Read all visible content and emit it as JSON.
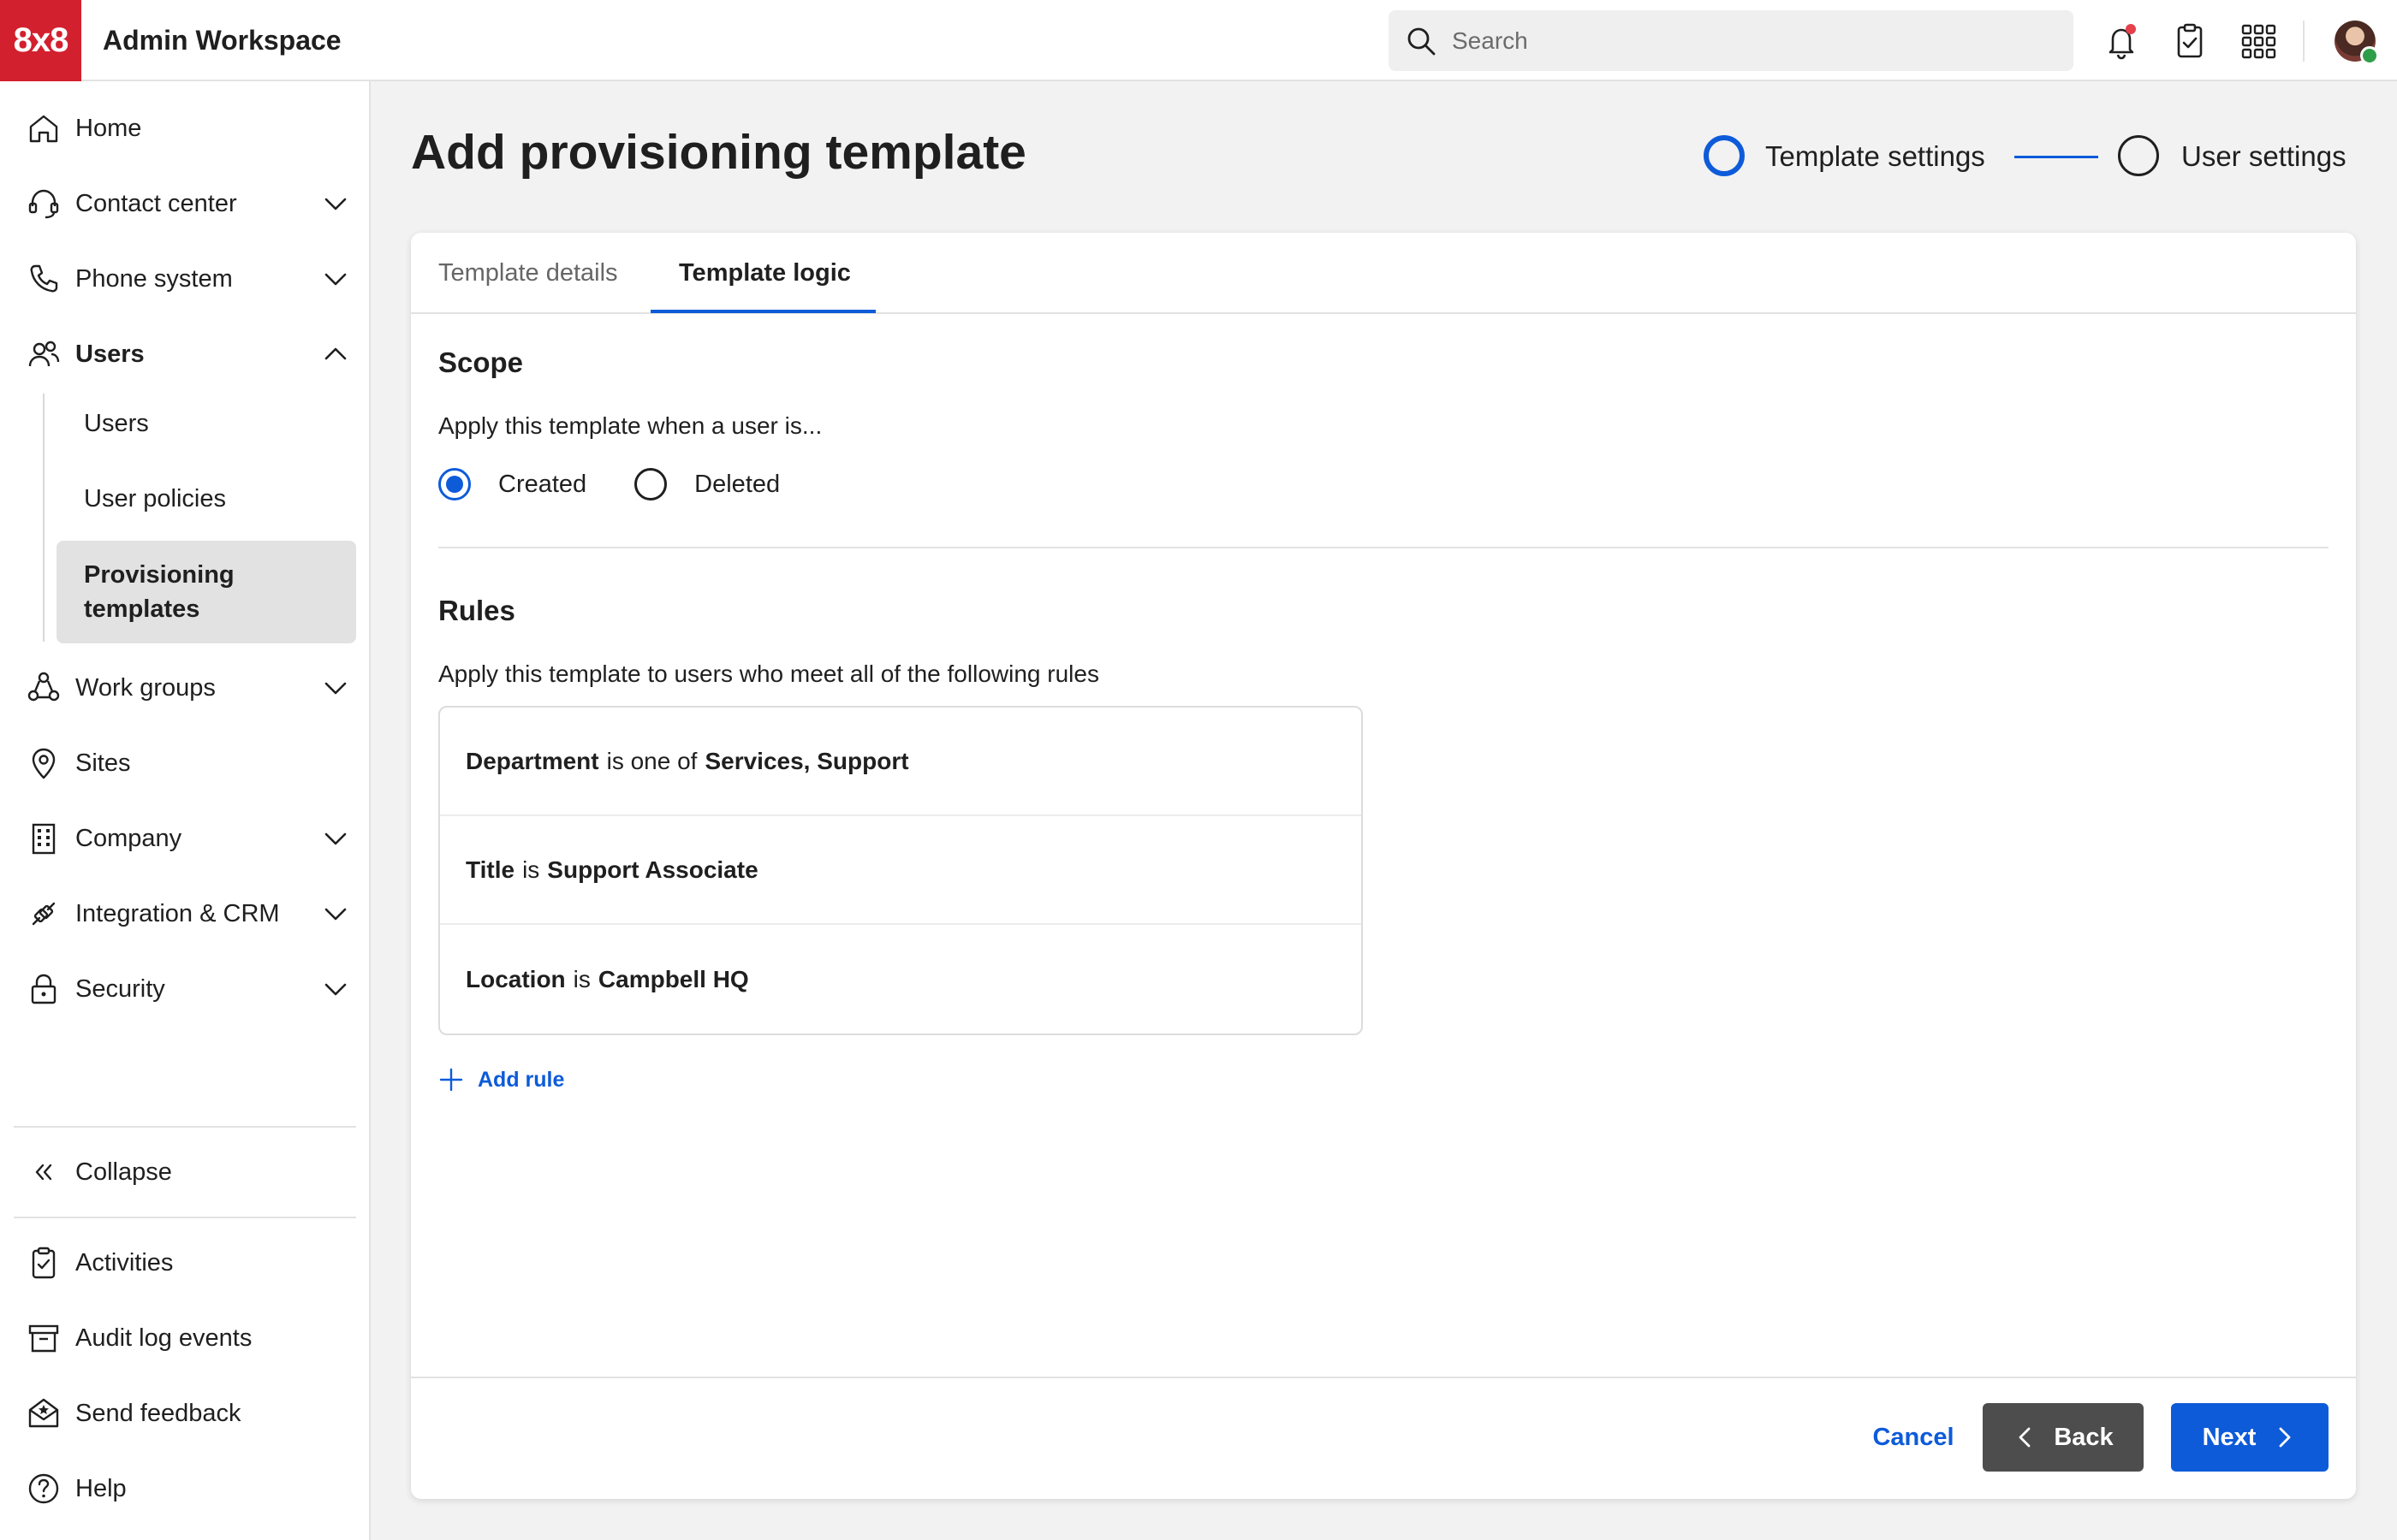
{
  "app": {
    "logo_text": "8x8",
    "title": "Admin Workspace"
  },
  "search": {
    "placeholder": "Search"
  },
  "topbar_icons": [
    "bell-icon",
    "clipboard-check-icon",
    "apps-grid-icon",
    "user-avatar"
  ],
  "colors": {
    "brand": "#d3202f",
    "accent": "#0d5bd9",
    "notification": "#e5414b",
    "presence": "#2e9e4a"
  },
  "sidebar": {
    "items": [
      {
        "label": "Home",
        "icon": "home-icon"
      },
      {
        "label": "Contact center",
        "icon": "headset-icon",
        "expandable": true
      },
      {
        "label": "Phone system",
        "icon": "phone-icon",
        "expandable": true
      },
      {
        "label": "Users",
        "icon": "users-icon",
        "expandable": true,
        "expanded": true
      },
      {
        "label": "Work groups",
        "icon": "work-groups-icon",
        "expandable": true
      },
      {
        "label": "Sites",
        "icon": "location-pin-icon"
      },
      {
        "label": "Company",
        "icon": "building-icon",
        "expandable": true
      },
      {
        "label": "Integration & CRM",
        "icon": "integration-icon",
        "expandable": true
      },
      {
        "label": "Security",
        "icon": "lock-icon",
        "expandable": true
      }
    ],
    "users_subitems": [
      {
        "label": "Users"
      },
      {
        "label": "User policies"
      },
      {
        "label": "Provisioning templates",
        "active": true
      }
    ],
    "collapse_label": "Collapse",
    "bottom_items": [
      {
        "label": "Activities",
        "icon": "clipboard-check-icon"
      },
      {
        "label": "Audit log events",
        "icon": "archive-icon"
      },
      {
        "label": "Send feedback",
        "icon": "feedback-icon"
      },
      {
        "label": "Help",
        "icon": "help-icon"
      }
    ]
  },
  "page": {
    "title": "Add provisioning template",
    "steps": [
      {
        "label": "Template settings",
        "state": "current"
      },
      {
        "label": "User settings",
        "state": "upcoming"
      }
    ]
  },
  "tabs": [
    {
      "label": "Template details",
      "active": false
    },
    {
      "label": "Template logic",
      "active": true
    }
  ],
  "scope": {
    "title": "Scope",
    "description": "Apply this template when a user is...",
    "options": [
      {
        "label": "Created",
        "checked": true
      },
      {
        "label": "Deleted",
        "checked": false
      }
    ]
  },
  "rules": {
    "title": "Rules",
    "description": "Apply this template to users who meet all of the following rules",
    "items": [
      {
        "field": "Department",
        "operator": "is one of",
        "value": "Services, Support"
      },
      {
        "field": "Title",
        "operator": "is",
        "value": "Support Associate"
      },
      {
        "field": "Location",
        "operator": "is",
        "value": "Campbell HQ"
      }
    ],
    "add_label": "Add rule"
  },
  "footer": {
    "cancel_label": "Cancel",
    "back_label": "Back",
    "next_label": "Next"
  }
}
